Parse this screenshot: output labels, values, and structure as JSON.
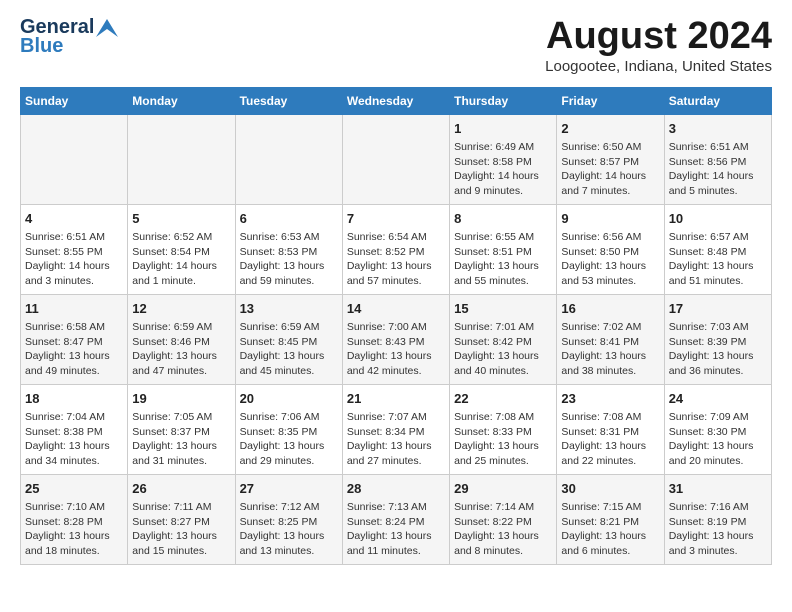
{
  "logo": {
    "general": "General",
    "blue": "Blue"
  },
  "title": "August 2024",
  "subtitle": "Loogootee, Indiana, United States",
  "headers": [
    "Sunday",
    "Monday",
    "Tuesday",
    "Wednesday",
    "Thursday",
    "Friday",
    "Saturday"
  ],
  "weeks": [
    [
      {
        "day": "",
        "content": ""
      },
      {
        "day": "",
        "content": ""
      },
      {
        "day": "",
        "content": ""
      },
      {
        "day": "",
        "content": ""
      },
      {
        "day": "1",
        "content": "Sunrise: 6:49 AM\nSunset: 8:58 PM\nDaylight: 14 hours\nand 9 minutes."
      },
      {
        "day": "2",
        "content": "Sunrise: 6:50 AM\nSunset: 8:57 PM\nDaylight: 14 hours\nand 7 minutes."
      },
      {
        "day": "3",
        "content": "Sunrise: 6:51 AM\nSunset: 8:56 PM\nDaylight: 14 hours\nand 5 minutes."
      }
    ],
    [
      {
        "day": "4",
        "content": "Sunrise: 6:51 AM\nSunset: 8:55 PM\nDaylight: 14 hours\nand 3 minutes."
      },
      {
        "day": "5",
        "content": "Sunrise: 6:52 AM\nSunset: 8:54 PM\nDaylight: 14 hours\nand 1 minute."
      },
      {
        "day": "6",
        "content": "Sunrise: 6:53 AM\nSunset: 8:53 PM\nDaylight: 13 hours\nand 59 minutes."
      },
      {
        "day": "7",
        "content": "Sunrise: 6:54 AM\nSunset: 8:52 PM\nDaylight: 13 hours\nand 57 minutes."
      },
      {
        "day": "8",
        "content": "Sunrise: 6:55 AM\nSunset: 8:51 PM\nDaylight: 13 hours\nand 55 minutes."
      },
      {
        "day": "9",
        "content": "Sunrise: 6:56 AM\nSunset: 8:50 PM\nDaylight: 13 hours\nand 53 minutes."
      },
      {
        "day": "10",
        "content": "Sunrise: 6:57 AM\nSunset: 8:48 PM\nDaylight: 13 hours\nand 51 minutes."
      }
    ],
    [
      {
        "day": "11",
        "content": "Sunrise: 6:58 AM\nSunset: 8:47 PM\nDaylight: 13 hours\nand 49 minutes."
      },
      {
        "day": "12",
        "content": "Sunrise: 6:59 AM\nSunset: 8:46 PM\nDaylight: 13 hours\nand 47 minutes."
      },
      {
        "day": "13",
        "content": "Sunrise: 6:59 AM\nSunset: 8:45 PM\nDaylight: 13 hours\nand 45 minutes."
      },
      {
        "day": "14",
        "content": "Sunrise: 7:00 AM\nSunset: 8:43 PM\nDaylight: 13 hours\nand 42 minutes."
      },
      {
        "day": "15",
        "content": "Sunrise: 7:01 AM\nSunset: 8:42 PM\nDaylight: 13 hours\nand 40 minutes."
      },
      {
        "day": "16",
        "content": "Sunrise: 7:02 AM\nSunset: 8:41 PM\nDaylight: 13 hours\nand 38 minutes."
      },
      {
        "day": "17",
        "content": "Sunrise: 7:03 AM\nSunset: 8:39 PM\nDaylight: 13 hours\nand 36 minutes."
      }
    ],
    [
      {
        "day": "18",
        "content": "Sunrise: 7:04 AM\nSunset: 8:38 PM\nDaylight: 13 hours\nand 34 minutes."
      },
      {
        "day": "19",
        "content": "Sunrise: 7:05 AM\nSunset: 8:37 PM\nDaylight: 13 hours\nand 31 minutes."
      },
      {
        "day": "20",
        "content": "Sunrise: 7:06 AM\nSunset: 8:35 PM\nDaylight: 13 hours\nand 29 minutes."
      },
      {
        "day": "21",
        "content": "Sunrise: 7:07 AM\nSunset: 8:34 PM\nDaylight: 13 hours\nand 27 minutes."
      },
      {
        "day": "22",
        "content": "Sunrise: 7:08 AM\nSunset: 8:33 PM\nDaylight: 13 hours\nand 25 minutes."
      },
      {
        "day": "23",
        "content": "Sunrise: 7:08 AM\nSunset: 8:31 PM\nDaylight: 13 hours\nand 22 minutes."
      },
      {
        "day": "24",
        "content": "Sunrise: 7:09 AM\nSunset: 8:30 PM\nDaylight: 13 hours\nand 20 minutes."
      }
    ],
    [
      {
        "day": "25",
        "content": "Sunrise: 7:10 AM\nSunset: 8:28 PM\nDaylight: 13 hours\nand 18 minutes."
      },
      {
        "day": "26",
        "content": "Sunrise: 7:11 AM\nSunset: 8:27 PM\nDaylight: 13 hours\nand 15 minutes."
      },
      {
        "day": "27",
        "content": "Sunrise: 7:12 AM\nSunset: 8:25 PM\nDaylight: 13 hours\nand 13 minutes."
      },
      {
        "day": "28",
        "content": "Sunrise: 7:13 AM\nSunset: 8:24 PM\nDaylight: 13 hours\nand 11 minutes."
      },
      {
        "day": "29",
        "content": "Sunrise: 7:14 AM\nSunset: 8:22 PM\nDaylight: 13 hours\nand 8 minutes."
      },
      {
        "day": "30",
        "content": "Sunrise: 7:15 AM\nSunset: 8:21 PM\nDaylight: 13 hours\nand 6 minutes."
      },
      {
        "day": "31",
        "content": "Sunrise: 7:16 AM\nSunset: 8:19 PM\nDaylight: 13 hours\nand 3 minutes."
      }
    ]
  ]
}
